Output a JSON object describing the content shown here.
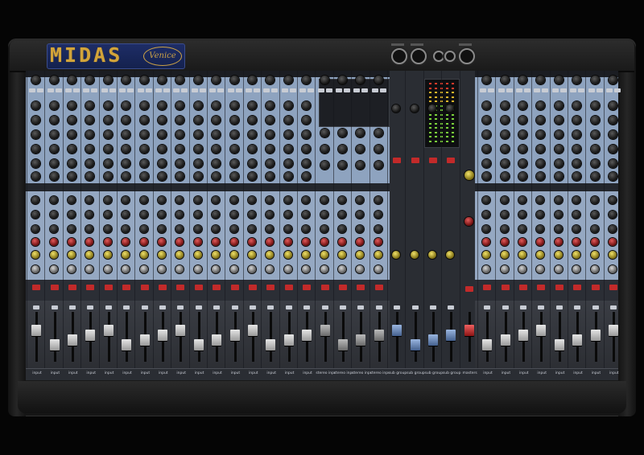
{
  "brand": "MIDAS",
  "model": "Venice",
  "colors": {
    "background": "#050505",
    "chassis": "#1e1e1e",
    "channel_blue": "#8ea3bf",
    "brand_gold": "#d2a43a",
    "logo_plate": "#1e2d66",
    "mute_red": "#c22a2a",
    "meter_green": "#7ad13a"
  },
  "strip_labels": [
    "input",
    "input",
    "input",
    "input",
    "input",
    "input",
    "input",
    "input",
    "input",
    "input",
    "input",
    "input",
    "input",
    "input",
    "input",
    "input",
    "stereo input",
    "stereo input",
    "stereo input",
    "stereo input",
    "sub group",
    "sub group",
    "sub group",
    "sub group",
    "masters",
    "input",
    "input",
    "input",
    "input",
    "input",
    "input",
    "input",
    "input"
  ]
}
